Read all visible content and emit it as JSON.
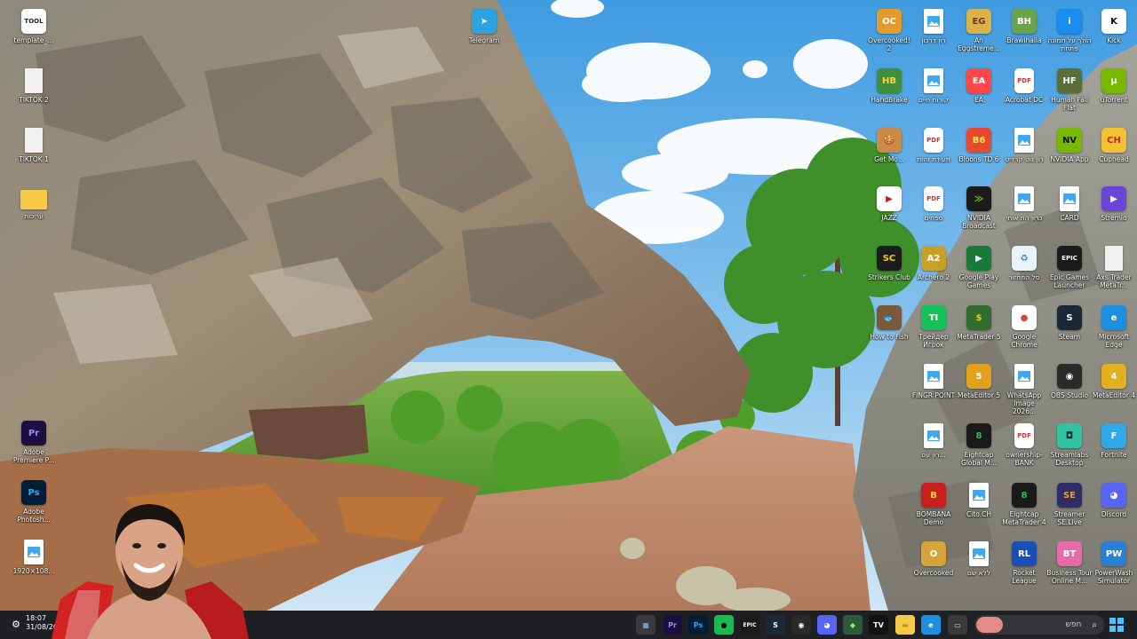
{
  "desktop_icons": [
    {
      "id": "template",
      "label": "template_...",
      "glyph": "TOOL",
      "color": "#ffffff",
      "fg": "#222222",
      "kind": "tool"
    },
    {
      "id": "tiktok2",
      "label": "TIKTOK 2",
      "glyph": "",
      "color": "#f1f1f1",
      "fg": "#999999",
      "kind": "file"
    },
    {
      "id": "tiktok1",
      "label": "TIKTOK 1",
      "glyph": "",
      "color": "#f1f1f1",
      "fg": "#999999",
      "kind": "file"
    },
    {
      "id": "folder",
      "label": "עריכות",
      "glyph": "",
      "color": "#f7c948",
      "fg": "#f7c948",
      "kind": "folder"
    },
    {
      "id": "premiere",
      "label": "Adobe Premiere P...",
      "glyph": "Pr",
      "color": "#1a0f3d",
      "fg": "#9a8cff",
      "kind": "app"
    },
    {
      "id": "photoshop",
      "label": "Adobe Photosh...",
      "glyph": "Ps",
      "color": "#001e36",
      "fg": "#31a8ff",
      "kind": "app"
    },
    {
      "id": "img1920",
      "label": "1920×108...",
      "glyph": "",
      "color": "#ffffff",
      "fg": "#2b7bd4",
      "kind": "doc"
    },
    {
      "id": "telegram",
      "label": "Telegram",
      "glyph": "➤",
      "color": "#2aa3e0",
      "fg": "#ffffff",
      "kind": "app"
    },
    {
      "id": "overcooked2",
      "label": "Overcooked! 2",
      "glyph": "OC",
      "color": "#e59a2c",
      "fg": "#ffffff",
      "kind": "app"
    },
    {
      "id": "ron1",
      "label": "רון דרכון",
      "glyph": "",
      "color": "#ffffff",
      "fg": "#2b7bd4",
      "kind": "doc"
    },
    {
      "id": "egg",
      "label": "An Eggstreme...",
      "glyph": "EG",
      "color": "#d9b24a",
      "fg": "#6b3d12",
      "kind": "app"
    },
    {
      "id": "brawlhalla",
      "label": "Brawlhalla",
      "glyph": "BH",
      "color": "#6aa34a",
      "fg": "#ffffff",
      "kind": "app"
    },
    {
      "id": "photo",
      "label": "הולך על תמונה פתחת",
      "glyph": "i",
      "color": "#1b8cf0",
      "fg": "#ffffff",
      "kind": "app"
    },
    {
      "id": "kick",
      "label": "Kick",
      "glyph": "K",
      "color": "#ffffff",
      "fg": "#0b0b0b",
      "kind": "app"
    },
    {
      "id": "handbrake",
      "label": "HandBrake",
      "glyph": "HB",
      "color": "#3f8f3f",
      "fg": "#ffd23a",
      "kind": "app"
    },
    {
      "id": "doc2",
      "label": "קורות חיים",
      "glyph": "",
      "color": "#ffffff",
      "fg": "#2b7bd4",
      "kind": "doc"
    },
    {
      "id": "ea",
      "label": "EA",
      "glyph": "EA",
      "color": "#ff4747",
      "fg": "#ffffff",
      "kind": "app"
    },
    {
      "id": "acrobat",
      "label": "Acrobat DC",
      "glyph": "PDF",
      "color": "#ffffff",
      "fg": "#d32f2f",
      "kind": "pdf"
    },
    {
      "id": "humanfall",
      "label": "Human Fall Flat",
      "glyph": "HF",
      "color": "#5a6e3a",
      "fg": "#ffffff",
      "kind": "app"
    },
    {
      "id": "utorrent",
      "label": "uTorrent",
      "glyph": "µ",
      "color": "#76b900",
      "fg": "#ffffff",
      "kind": "app"
    },
    {
      "id": "getmonk",
      "label": "Get Mo...",
      "glyph": "🍪",
      "color": "#c98a4a",
      "fg": "#ffffff",
      "kind": "app"
    },
    {
      "id": "pdf1",
      "label": "תעודת זהות",
      "glyph": "PDF",
      "color": "#ffffff",
      "fg": "#d32f2f",
      "kind": "pdf"
    },
    {
      "id": "bloons",
      "label": "Bloons TD 6",
      "glyph": "B6",
      "color": "#e64a2e",
      "fg": "#ffe14d",
      "kind": "app"
    },
    {
      "id": "doc3",
      "label": "רון נוט קרדיט",
      "glyph": "",
      "color": "#ffffff",
      "fg": "#2b7bd4",
      "kind": "doc"
    },
    {
      "id": "nvidia",
      "label": "NVIDIA App",
      "glyph": "NV",
      "color": "#76b900",
      "fg": "#111111",
      "kind": "app"
    },
    {
      "id": "cuphead",
      "label": "Cuphead",
      "glyph": "CH",
      "color": "#f2c230",
      "fg": "#c41e1e",
      "kind": "app"
    },
    {
      "id": "jazz",
      "label": "JAZZ",
      "glyph": "▶",
      "color": "#ffffff",
      "fg": "#c41e1e",
      "kind": "app"
    },
    {
      "id": "pdf2",
      "label": "ספחים",
      "glyph": "PDF",
      "color": "#ffffff",
      "fg": "#d32f2f",
      "kind": "pdf"
    },
    {
      "id": "nvbroadcast",
      "label": "NVIDIA Broadcast",
      "glyph": "≫",
      "color": "#1b1b1b",
      "fg": "#76b900",
      "kind": "app"
    },
    {
      "id": "doc4",
      "label": "כרון הת אותי",
      "glyph": "",
      "color": "#ffffff",
      "fg": "#2b7bd4",
      "kind": "doc"
    },
    {
      "id": "card",
      "label": "CARD",
      "glyph": "",
      "color": "#ffffff",
      "fg": "#2b7bd4",
      "kind": "doc"
    },
    {
      "id": "stremio",
      "label": "Stremio",
      "glyph": "▶",
      "color": "#6a45d6",
      "fg": "#ffffff",
      "kind": "app"
    },
    {
      "id": "strikers",
      "label": "Strikers Club",
      "glyph": "SC",
      "color": "#1c1c1c",
      "fg": "#f6d000",
      "kind": "app"
    },
    {
      "id": "archero2",
      "label": "Archero 2",
      "glyph": "A2",
      "color": "#c7a02a",
      "fg": "#ffffff",
      "kind": "app"
    },
    {
      "id": "googleplay",
      "label": "Google Play Games",
      "glyph": "▶",
      "color": "#1a7a3a",
      "fg": "#ffffff",
      "kind": "app"
    },
    {
      "id": "recycle",
      "label": "סל המחזור",
      "glyph": "♻",
      "color": "#e9f3fb",
      "fg": "#3a78c2",
      "kind": "app"
    },
    {
      "id": "epic",
      "label": "Epic Games Launcher",
      "glyph": "EPIC",
      "color": "#1a1a1a",
      "fg": "#ffffff",
      "kind": "app"
    },
    {
      "id": "axs",
      "label": "Axs Trader MetaTr...",
      "glyph": "",
      "color": "#f1f1f1",
      "fg": "#999999",
      "kind": "file"
    },
    {
      "id": "howtofish",
      "label": "How to Fish",
      "glyph": "🐟",
      "color": "#7a5a3a",
      "fg": "#ffffff",
      "kind": "app"
    },
    {
      "id": "trader",
      "label": "Трейдер Игрок",
      "glyph": "TI",
      "color": "#15c25a",
      "fg": "#ffffff",
      "kind": "app"
    },
    {
      "id": "mt5",
      "label": "MetaTrader 5",
      "glyph": "$",
      "color": "#2f6e2f",
      "fg": "#f1c40f",
      "kind": "app"
    },
    {
      "id": "chrome",
      "label": "Google Chrome",
      "glyph": "●",
      "color": "#ffffff",
      "fg": "#db4437",
      "kind": "app"
    },
    {
      "id": "steam",
      "label": "Steam",
      "glyph": "S",
      "color": "#1b2838",
      "fg": "#ffffff",
      "kind": "app"
    },
    {
      "id": "edge",
      "label": "Microsoft Edge",
      "glyph": "e",
      "color": "#1d8fe0",
      "fg": "#ffffff",
      "kind": "app"
    },
    {
      "id": "fingerpoint",
      "label": "FINGR POINT",
      "glyph": "",
      "color": "#ffffff",
      "fg": "#2b7bd4",
      "kind": "doc"
    },
    {
      "id": "metaeditor5",
      "label": "MetaEditor 5",
      "glyph": "5",
      "color": "#e0a21a",
      "fg": "#ffffff",
      "kind": "app"
    },
    {
      "id": "whatsimg",
      "label": "WhatsApp Image 2026...",
      "glyph": "",
      "color": "#ffffff",
      "fg": "#2b7bd4",
      "kind": "doc"
    },
    {
      "id": "obs",
      "label": "OBS Studio",
      "glyph": "◉",
      "color": "#2a2a2a",
      "fg": "#ffffff",
      "kind": "app"
    },
    {
      "id": "metaeditor",
      "label": "MetaEditor 4",
      "glyph": "4",
      "color": "#e0b020",
      "fg": "#ffffff",
      "kind": "app"
    },
    {
      "id": "doc5",
      "label": "רון עם...",
      "glyph": "",
      "color": "#ffffff",
      "fg": "#2b7bd4",
      "kind": "doc"
    },
    {
      "id": "eightcap",
      "label": "Eightcap Global M...",
      "glyph": "8",
      "color": "#1a1a1a",
      "fg": "#22c55e",
      "kind": "app"
    },
    {
      "id": "ownership",
      "label": "ownership-BANK",
      "glyph": "PDF",
      "color": "#ffffff",
      "fg": "#d32f2f",
      "kind": "pdf"
    },
    {
      "id": "streamlabs",
      "label": "Streamlabs Desktop",
      "glyph": "◘",
      "color": "#31c3a2",
      "fg": "#0b2a24",
      "kind": "app"
    },
    {
      "id": "fortnite",
      "label": "Fortnite",
      "glyph": "F",
      "color": "#2fa9e8",
      "fg": "#ffffff",
      "kind": "app"
    },
    {
      "id": "bombana",
      "label": "BOMBANA Demo",
      "glyph": "B",
      "color": "#c8201e",
      "fg": "#ffd23a",
      "kind": "app"
    },
    {
      "id": "doc6",
      "label": "Cito.CH",
      "glyph": "",
      "color": "#ffffff",
      "fg": "#2b7bd4",
      "kind": "doc"
    },
    {
      "id": "eightcap4",
      "label": "Eightcap MetaTrader 4",
      "glyph": "8",
      "color": "#1a1a1a",
      "fg": "#22c55e",
      "kind": "app"
    },
    {
      "id": "streamerbot",
      "label": "Streamer SE.Live",
      "glyph": "SE",
      "color": "#2d2d6a",
      "fg": "#f59e0b",
      "kind": "app"
    },
    {
      "id": "discord",
      "label": "Discord",
      "glyph": "◕",
      "color": "#5865f2",
      "fg": "#ffffff",
      "kind": "app"
    },
    {
      "id": "overcooked",
      "label": "Overcooked",
      "glyph": "O",
      "color": "#d5a33a",
      "fg": "#ffffff",
      "kind": "app"
    },
    {
      "id": "doc7",
      "label": "ללא שם",
      "glyph": "",
      "color": "#ffffff",
      "fg": "#2b7bd4",
      "kind": "doc"
    },
    {
      "id": "rocket",
      "label": "Rocket League",
      "glyph": "RL",
      "color": "#1a4fb8",
      "fg": "#ffffff",
      "kind": "app"
    },
    {
      "id": "business",
      "label": "Business Tour Online M...",
      "glyph": "BT",
      "color": "#e86aa8",
      "fg": "#ffffff",
      "kind": "app"
    },
    {
      "id": "powerwash",
      "label": "PowerWash Simulator",
      "glyph": "PW",
      "color": "#2a7fd4",
      "fg": "#ffffff",
      "kind": "app"
    }
  ],
  "taskbar": {
    "time": "18:07",
    "date": "31/08/20",
    "search_placeholder": "חפש",
    "apps": [
      {
        "id": "calculator",
        "glyph": "▦",
        "color": "#3a3a3a",
        "fg": "#7fb7ff"
      },
      {
        "id": "premiere",
        "glyph": "Pr",
        "color": "#1a0f3d",
        "fg": "#9a8cff"
      },
      {
        "id": "photoshop",
        "glyph": "Ps",
        "color": "#001e36",
        "fg": "#31a8ff"
      },
      {
        "id": "spotify",
        "glyph": "●",
        "color": "#1db954",
        "fg": "#111111"
      },
      {
        "id": "epic",
        "glyph": "EPIC",
        "color": "#1a1a1a",
        "fg": "#ffffff"
      },
      {
        "id": "steam",
        "glyph": "S",
        "color": "#1b2838",
        "fg": "#ffffff"
      },
      {
        "id": "obs",
        "glyph": "◉",
        "color": "#2a2a2a",
        "fg": "#ffffff"
      },
      {
        "id": "discord",
        "glyph": "◕",
        "color": "#5865f2",
        "fg": "#ffffff"
      },
      {
        "id": "app9",
        "glyph": "◆",
        "color": "#2d5a3a",
        "fg": "#9ce27a"
      },
      {
        "id": "tradingview",
        "glyph": "TV",
        "color": "#111111",
        "fg": "#ffffff"
      },
      {
        "id": "explorer",
        "glyph": "▬",
        "color": "#f7c948",
        "fg": "#c9901a"
      },
      {
        "id": "edge",
        "glyph": "e",
        "color": "#1d8fe0",
        "fg": "#ffffff"
      },
      {
        "id": "app13",
        "glyph": "▭",
        "color": "#3a3a3a",
        "fg": "#dddddd"
      }
    ]
  }
}
